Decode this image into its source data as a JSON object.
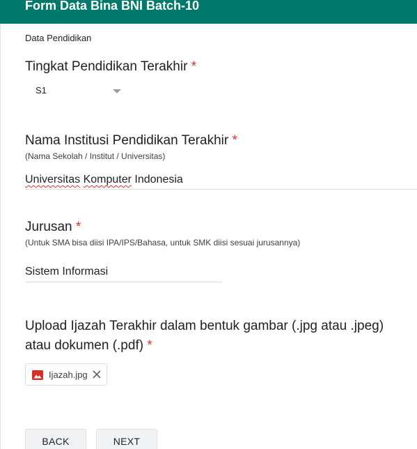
{
  "header": {
    "title": "Form Data Bina BNI Batch-10"
  },
  "section": {
    "title": "Data Pendidikan"
  },
  "questions": {
    "education_level": {
      "title": "Tingkat Pendidikan Terakhir",
      "required_mark": "*",
      "selected": "S1"
    },
    "institution": {
      "title": "Nama Institusi Pendidikan Terakhir",
      "required_mark": "*",
      "help": "(Nama Sekolah / Institut / Universitas)",
      "answer_part1": "Universitas",
      "answer_space1": " ",
      "answer_part2": "Komputer",
      "answer_part3": " Indonesia"
    },
    "major": {
      "title": "Jurusan",
      "required_mark": "*",
      "help": "(Untuk SMA bisa diisi IPA/IPS/Bahasa, untuk SMK diisi sesuai jurusannya)",
      "answer": "Sistem Informasi"
    },
    "upload": {
      "title_line1": "Upload Ijazah Terakhir dalam bentuk gambar (.jpg atau .jpeg)",
      "title_line2": "atau dokumen (.pdf)",
      "required_mark": "*",
      "file_name": "Ijazah.jpg",
      "file_icon": "image-file-icon",
      "remove_icon": "close-icon"
    }
  },
  "buttons": {
    "back": "BACK",
    "next": "NEXT"
  },
  "colors": {
    "header_bg": "#00796b",
    "required": "#d93025",
    "file_icon": "#d93025"
  }
}
